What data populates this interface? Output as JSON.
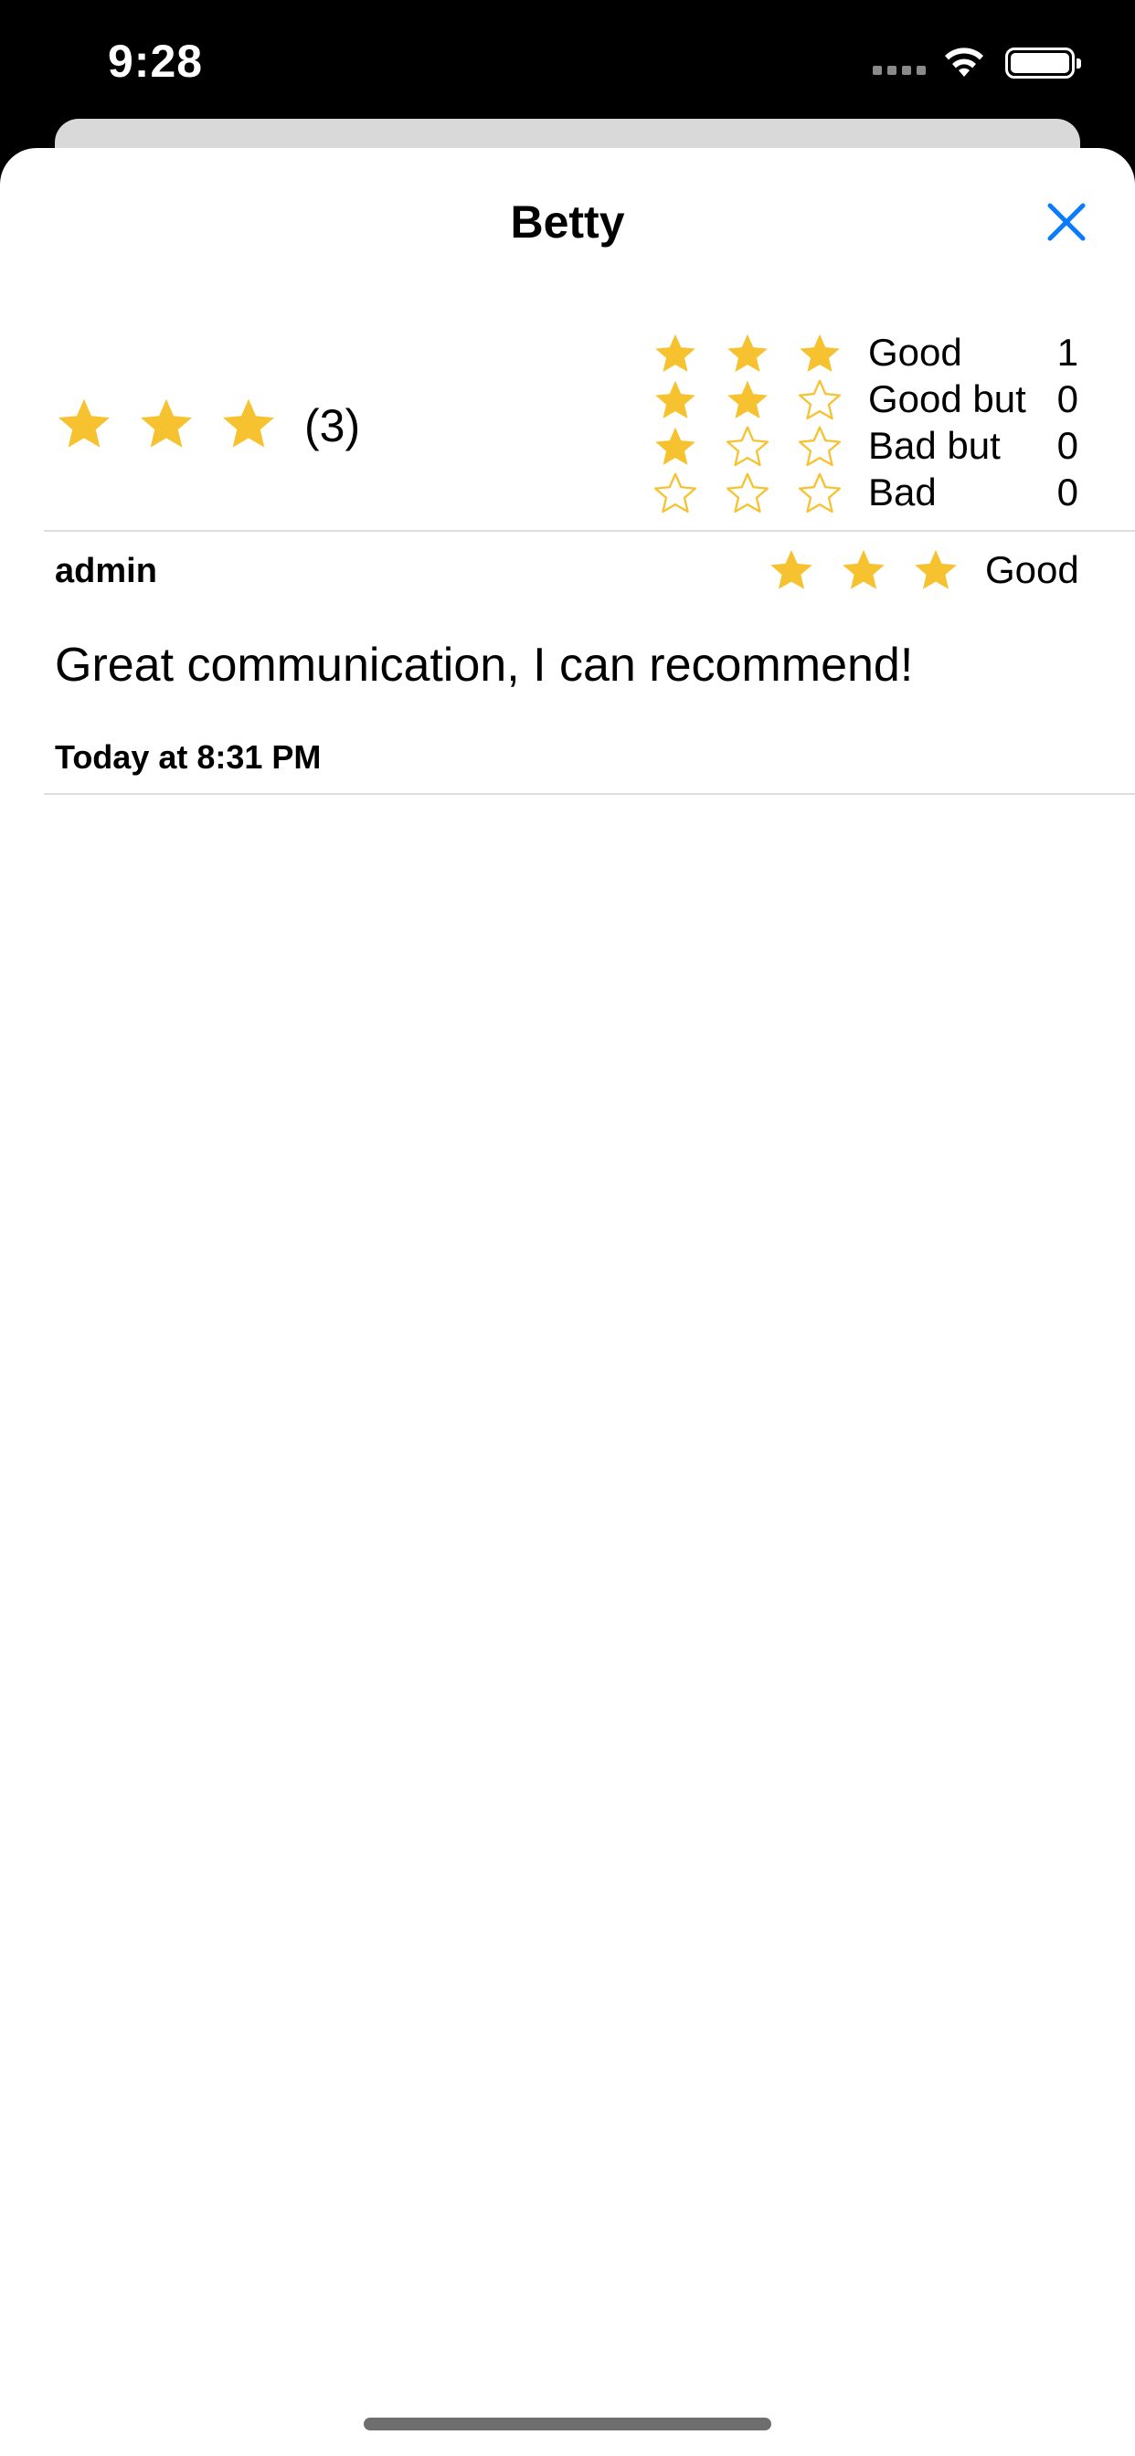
{
  "status_bar": {
    "time": "9:28"
  },
  "sheet": {
    "title": "Betty",
    "close_icon": "close-icon"
  },
  "colors": {
    "star": "#F7C230",
    "accent": "#0A7AFF"
  },
  "rating_summary": {
    "stars": 3,
    "max_stars": 3,
    "count_label": "(3)"
  },
  "rating_distribution": [
    {
      "label": "Good",
      "stars": 3,
      "count": "1"
    },
    {
      "label": "Good but",
      "stars": 2,
      "count": "0"
    },
    {
      "label": "Bad but",
      "stars": 1,
      "count": "0"
    },
    {
      "label": "Bad",
      "stars": 0,
      "count": "0"
    }
  ],
  "review": {
    "author": "admin",
    "stars": 3,
    "rating_label": "Good",
    "text": "Great communication, I can recommend!",
    "date": "Today at 8:31 PM"
  }
}
